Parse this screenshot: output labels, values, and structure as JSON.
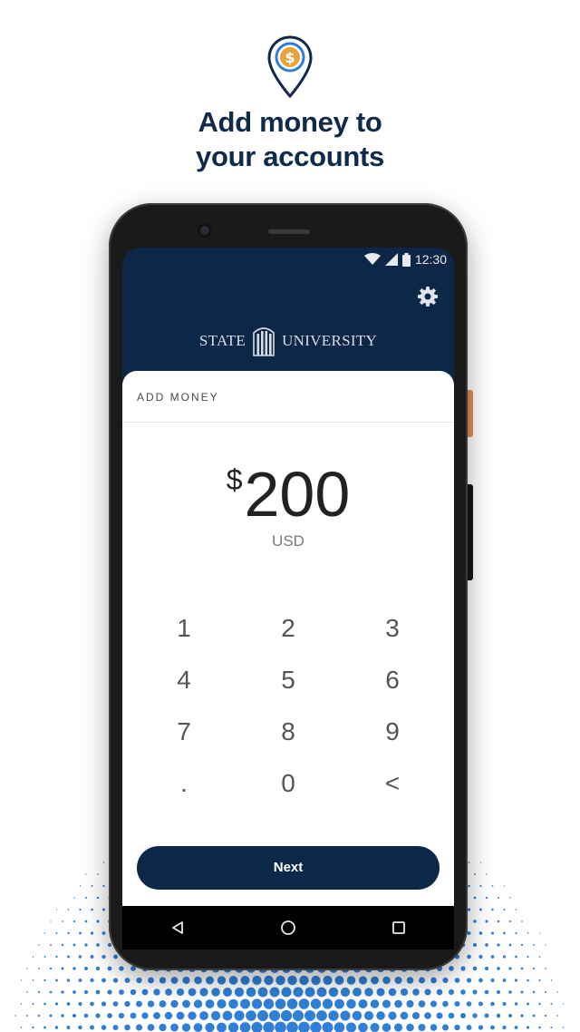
{
  "headline": {
    "line1": "Add money to",
    "line2": "your accounts"
  },
  "icons": {
    "location_pin": "dollar-location-pin-icon",
    "gear": "gear-icon"
  },
  "status_bar": {
    "time": "12:30"
  },
  "brand": {
    "left": "STATE",
    "right": "UNIVERSITY"
  },
  "add_money": {
    "title": "ADD MONEY",
    "currency_symbol": "$",
    "amount": "200",
    "currency_code": "USD"
  },
  "keypad": {
    "keys": [
      "1",
      "2",
      "3",
      "4",
      "5",
      "6",
      "7",
      "8",
      "9",
      ".",
      "0",
      "<"
    ]
  },
  "next_label": "Next",
  "colors": {
    "navy": "#0c2747",
    "headline": "#0f2a4a",
    "dot_blue": "#2f7fd6",
    "accent_orange": "#e8a33a"
  }
}
